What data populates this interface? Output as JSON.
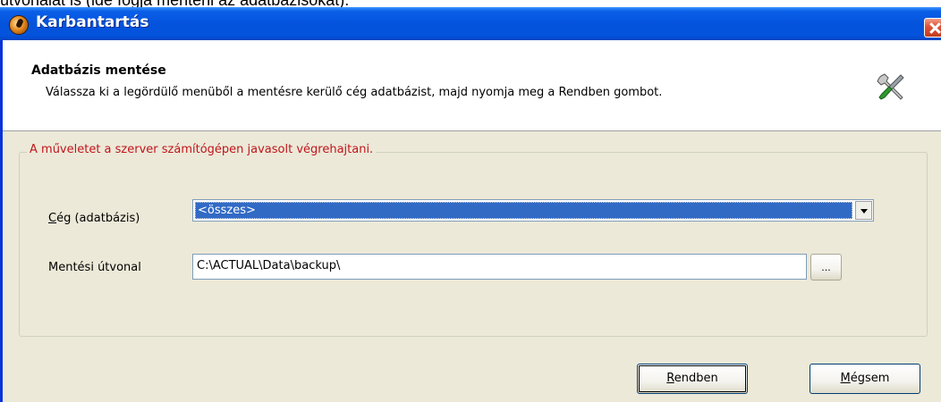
{
  "background_text": "útvonalat is (ide fogja menteni az adatbázisokat).",
  "window": {
    "title": "Karbantartás",
    "close_icon": "close-x-icon"
  },
  "header": {
    "title": "Adatbázis mentése",
    "description": "Válassza ki a legördülő menüből a mentésre kerülő cég adatbázist, majd nyomja meg a Rendben gombot.",
    "icon": "tools-wrench-screwdriver-icon"
  },
  "group": {
    "legend": "A műveletet a szerver számítógépen javasolt végrehajtani.",
    "company": {
      "label_accel": "C",
      "label_rest": "ég (adatbázis)",
      "value": "<összes>"
    },
    "path": {
      "label": "Mentési útvonal",
      "value": "C:\\ACTUAL\\Data\\backup\\",
      "browse_label": "..."
    }
  },
  "buttons": {
    "ok_accel": "R",
    "ok_rest": "endben",
    "cancel_accel": "M",
    "cancel_rest": "égsem"
  },
  "colors": {
    "titlebar": "#0453dd",
    "legend_text": "#c0151b",
    "selection": "#316ac5",
    "dialog_bg": "#ece9d8"
  }
}
